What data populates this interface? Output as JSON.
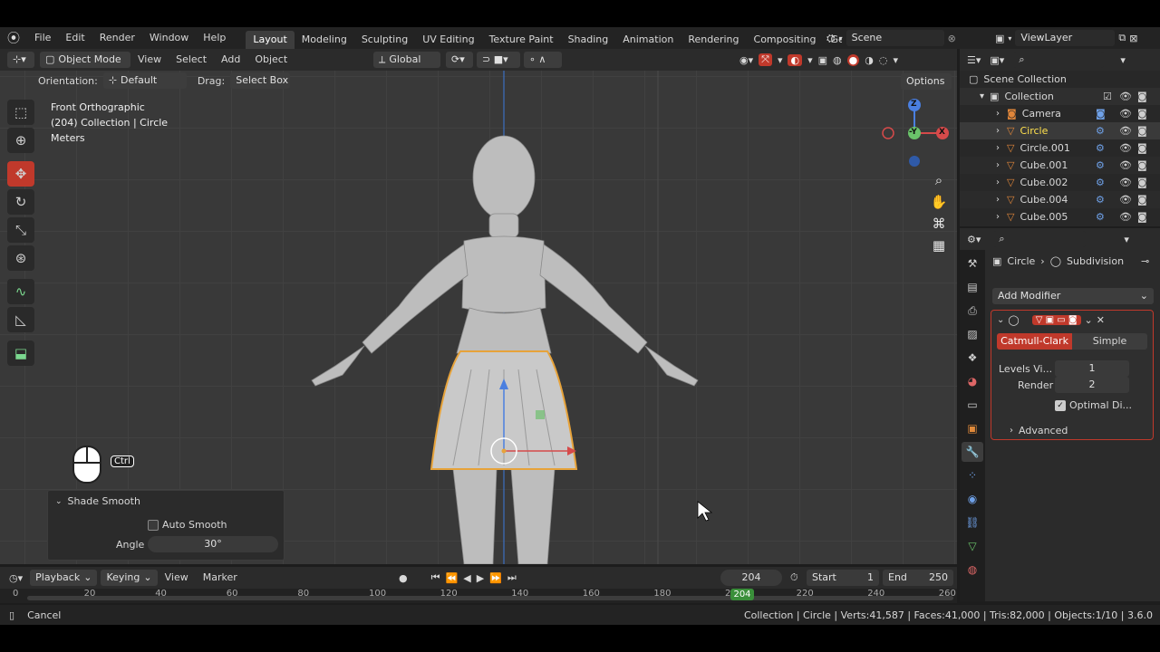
{
  "menu": {
    "file": "File",
    "edit": "Edit",
    "render": "Render",
    "window": "Window",
    "help": "Help"
  },
  "workspaces": [
    "Layout",
    "Modeling",
    "Sculpting",
    "UV Editing",
    "Texture Paint",
    "Shading",
    "Animation",
    "Rendering",
    "Compositing",
    "Geometry Noc"
  ],
  "scene": {
    "label": "Scene"
  },
  "view_layer": {
    "label": "ViewLayer"
  },
  "viewport_header": {
    "mode": "Object Mode",
    "view": "View",
    "select": "Select",
    "add": "Add",
    "object": "Object",
    "transform": "Global"
  },
  "tool_settings": {
    "orientation_label": "Orientation:",
    "orientation_value": "Default",
    "drag_label": "Drag:",
    "drag_value": "Select Box",
    "options": "Options"
  },
  "overlay_text": {
    "line1": "Front Orthographic",
    "line2": "(204) Collection | Circle",
    "line3": "Meters"
  },
  "gizmo": {
    "z": "Z",
    "y": "-Y",
    "x": "X"
  },
  "key_hint": {
    "ctrl": "Ctrl"
  },
  "last_op": {
    "title": "Shade Smooth",
    "auto_smooth": "Auto Smooth",
    "angle_label": "Angle",
    "angle_value": "30°"
  },
  "outliner": {
    "scene_collection": "Scene Collection",
    "collection": "Collection",
    "items": [
      {
        "name": "Camera",
        "icon": "camera-icon"
      },
      {
        "name": "Circle",
        "icon": "mesh-icon"
      },
      {
        "name": "Circle.001",
        "icon": "mesh-icon"
      },
      {
        "name": "Cube.001",
        "icon": "mesh-icon"
      },
      {
        "name": "Cube.002",
        "icon": "mesh-icon"
      },
      {
        "name": "Cube.004",
        "icon": "mesh-icon"
      },
      {
        "name": "Cube.005",
        "icon": "mesh-icon"
      }
    ]
  },
  "properties": {
    "breadcrumb_object": "Circle",
    "breadcrumb_modifier": "Subdivision",
    "add_modifier": "Add Modifier",
    "catmull": "Catmull-Clark",
    "simple": "Simple",
    "levels_label": "Levels Vi...",
    "levels_value": "1",
    "render_label": "Render",
    "render_value": "2",
    "optimal": "Optimal Di...",
    "advanced": "Advanced"
  },
  "timeline": {
    "playback": "Playback",
    "keying": "Keying",
    "view": "View",
    "marker": "Marker",
    "current_frame": "204",
    "start_label": "Start",
    "start_value": "1",
    "end_label": "End",
    "end_value": "250",
    "ticks": [
      "0",
      "20",
      "40",
      "60",
      "80",
      "100",
      "120",
      "140",
      "160",
      "180",
      "200",
      "220",
      "240",
      "260"
    ],
    "ruler_frame": "204"
  },
  "status": {
    "cancel": "Cancel",
    "stats": "Collection | Circle | Verts:41,587 | Faces:41,000 | Tris:82,000 | Objects:1/10 | 3.6.0"
  },
  "colors": {
    "accent": "#5680c2",
    "active_red": "#c0392b",
    "selected_orange": "#e7a33a",
    "active_text": "#ffe14d"
  }
}
